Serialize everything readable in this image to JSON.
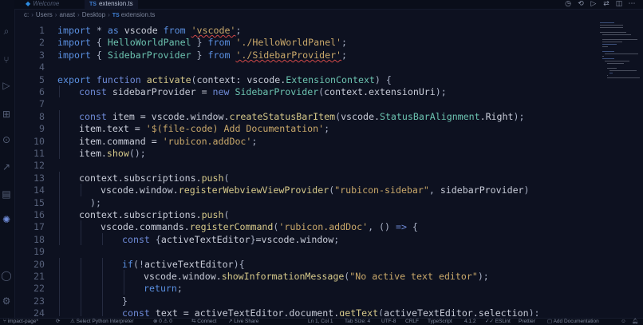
{
  "tabs": [
    {
      "label": "Welcome",
      "icon": "vscode-icon",
      "active": false
    },
    {
      "label": "extension.ts",
      "lang": "TS",
      "active": true
    }
  ],
  "breadcrumb": [
    "c:",
    "Users",
    "anast",
    "Desktop",
    "extension.ts"
  ],
  "breadcrumb_ts": "TS",
  "code_lines": [
    {
      "n": "1",
      "tokens": [
        [
          "kw",
          "import"
        ],
        [
          "p",
          " * "
        ],
        [
          "kw",
          "as"
        ],
        [
          "v",
          " vscode "
        ],
        [
          "kw",
          "from"
        ],
        [
          "v",
          " "
        ],
        [
          "su",
          "'vscode'"
        ],
        [
          "p",
          ";"
        ]
      ]
    },
    {
      "n": "2",
      "tokens": [
        [
          "kw",
          "import"
        ],
        [
          "p",
          " { "
        ],
        [
          "t",
          "HelloWorldPanel"
        ],
        [
          "p",
          " } "
        ],
        [
          "kw",
          "from"
        ],
        [
          "v",
          " "
        ],
        [
          "s",
          "'./HelloWorldPanel'"
        ],
        [
          "p",
          ";"
        ]
      ]
    },
    {
      "n": "3",
      "tokens": [
        [
          "kw",
          "import"
        ],
        [
          "p",
          " { "
        ],
        [
          "t",
          "SidebarProvider"
        ],
        [
          "p",
          " } "
        ],
        [
          "kw",
          "from"
        ],
        [
          "v",
          " "
        ],
        [
          "su",
          "'./SidebarProvider'"
        ],
        [
          "p",
          ";"
        ]
      ]
    },
    {
      "n": "4",
      "tokens": []
    },
    {
      "n": "5",
      "tokens": [
        [
          "kw",
          "export"
        ],
        [
          "v",
          " "
        ],
        [
          "k",
          "function"
        ],
        [
          "v",
          " "
        ],
        [
          "f",
          "activate"
        ],
        [
          "p",
          "("
        ],
        [
          "v",
          "context: vscode."
        ],
        [
          "t",
          "ExtensionContext"
        ],
        [
          "p",
          ") {"
        ]
      ]
    },
    {
      "n": "6",
      "indent": 1,
      "tokens": [
        [
          "k",
          "const"
        ],
        [
          "v",
          " sidebarProvider = "
        ],
        [
          "k",
          "new"
        ],
        [
          "v",
          " "
        ],
        [
          "t",
          "SidebarProvider"
        ],
        [
          "p",
          "("
        ],
        [
          "v",
          "context.extensionUri"
        ],
        [
          "p",
          ");"
        ]
      ]
    },
    {
      "n": "7",
      "tokens": []
    },
    {
      "n": "8",
      "indent": 1,
      "tokens": [
        [
          "k",
          "const"
        ],
        [
          "v",
          " item = vscode.window."
        ],
        [
          "f",
          "createStatusBarItem"
        ],
        [
          "p",
          "("
        ],
        [
          "v",
          "vscode."
        ],
        [
          "t",
          "StatusBarAlignment"
        ],
        [
          "v",
          ".Right"
        ],
        [
          "p",
          ");"
        ]
      ]
    },
    {
      "n": "9",
      "indent": 1,
      "tokens": [
        [
          "v",
          "item.text = "
        ],
        [
          "s",
          "'$(file-code) Add Documentation'"
        ],
        [
          "p",
          ";"
        ]
      ]
    },
    {
      "n": "10",
      "indent": 1,
      "tokens": [
        [
          "v",
          "item.command = "
        ],
        [
          "s",
          "'rubicon.addDoc'"
        ],
        [
          "p",
          ";"
        ]
      ]
    },
    {
      "n": "11",
      "indent": 1,
      "tokens": [
        [
          "v",
          "item."
        ],
        [
          "f",
          "show"
        ],
        [
          "p",
          "();"
        ]
      ]
    },
    {
      "n": "12",
      "tokens": []
    },
    {
      "n": "13",
      "indent": 1,
      "tokens": [
        [
          "v",
          "context.subscriptions."
        ],
        [
          "f",
          "push"
        ],
        [
          "p",
          "("
        ]
      ]
    },
    {
      "n": "14",
      "indent": 2,
      "tokens": [
        [
          "v",
          "vscode.window."
        ],
        [
          "f",
          "registerWebviewViewProvider"
        ],
        [
          "p",
          "("
        ],
        [
          "s",
          "\"rubicon-sidebar\""
        ],
        [
          "p",
          ", "
        ],
        [
          "v",
          "sidebarProvider"
        ],
        [
          "p",
          ")"
        ]
      ]
    },
    {
      "n": "15",
      "indent": 1,
      "tokens": [
        [
          "p",
          "  );"
        ]
      ]
    },
    {
      "n": "16",
      "indent": 1,
      "tokens": [
        [
          "v",
          "context.subscriptions."
        ],
        [
          "f",
          "push"
        ],
        [
          "p",
          "("
        ]
      ]
    },
    {
      "n": "17",
      "indent": 2,
      "tokens": [
        [
          "v",
          "vscode.commands."
        ],
        [
          "f",
          "registerCommand"
        ],
        [
          "p",
          "("
        ],
        [
          "s",
          "'rubicon.addDoc'"
        ],
        [
          "p",
          ", () "
        ],
        [
          "k",
          "=>"
        ],
        [
          "p",
          " {"
        ]
      ]
    },
    {
      "n": "18",
      "indent": 3,
      "tokens": [
        [
          "k",
          "const"
        ],
        [
          "p",
          " {"
        ],
        [
          "v",
          "activeTextEditor"
        ],
        [
          "p",
          "}"
        ],
        [
          "v",
          "=vscode.window"
        ],
        [
          "p",
          ";"
        ]
      ]
    },
    {
      "n": "19",
      "tokens": []
    },
    {
      "n": "20",
      "indent": 3,
      "tokens": [
        [
          "kw",
          "if"
        ],
        [
          "p",
          "(!"
        ],
        [
          "v",
          "activeTextEditor"
        ],
        [
          "p",
          "){"
        ]
      ]
    },
    {
      "n": "21",
      "indent": 4,
      "tokens": [
        [
          "v",
          "vscode.window."
        ],
        [
          "f",
          "showInformationMessage"
        ],
        [
          "p",
          "("
        ],
        [
          "s",
          "\"No active text editor\""
        ],
        [
          "p",
          ");"
        ]
      ]
    },
    {
      "n": "22",
      "indent": 4,
      "tokens": [
        [
          "kw",
          "return"
        ],
        [
          "p",
          ";"
        ]
      ]
    },
    {
      "n": "23",
      "indent": 3,
      "tokens": [
        [
          "p",
          "}"
        ]
      ]
    },
    {
      "n": "24",
      "indent": 3,
      "tokens": [
        [
          "k",
          "const"
        ],
        [
          "v",
          " text = activeTextEditor.document."
        ],
        [
          "f",
          "getText"
        ],
        [
          "p",
          "("
        ],
        [
          "v",
          "activeTextEditor.selection"
        ],
        [
          "p",
          ");"
        ]
      ]
    }
  ],
  "status_bar": {
    "branch": "impact-page*",
    "python": "Select Python Interpreter",
    "problems": "⊗ 0 ⚠ 0",
    "connect": "Connect",
    "live_share": "Live Share",
    "position": "Ln 1, Col 1",
    "tab_size": "Tab Size: 4",
    "encoding": "UTF-8",
    "eol": "CRLF",
    "language": "TypeScript",
    "ts_version": "4.1.2",
    "eslint": "ESLint",
    "prettier": "Prettier",
    "add_doc": "Add Documentation"
  },
  "colors": {
    "background": "#0d1120",
    "keyword": "#5a8fe0",
    "string": "#c9a86a",
    "function": "#d6c98a",
    "type": "#6cc3b0"
  }
}
